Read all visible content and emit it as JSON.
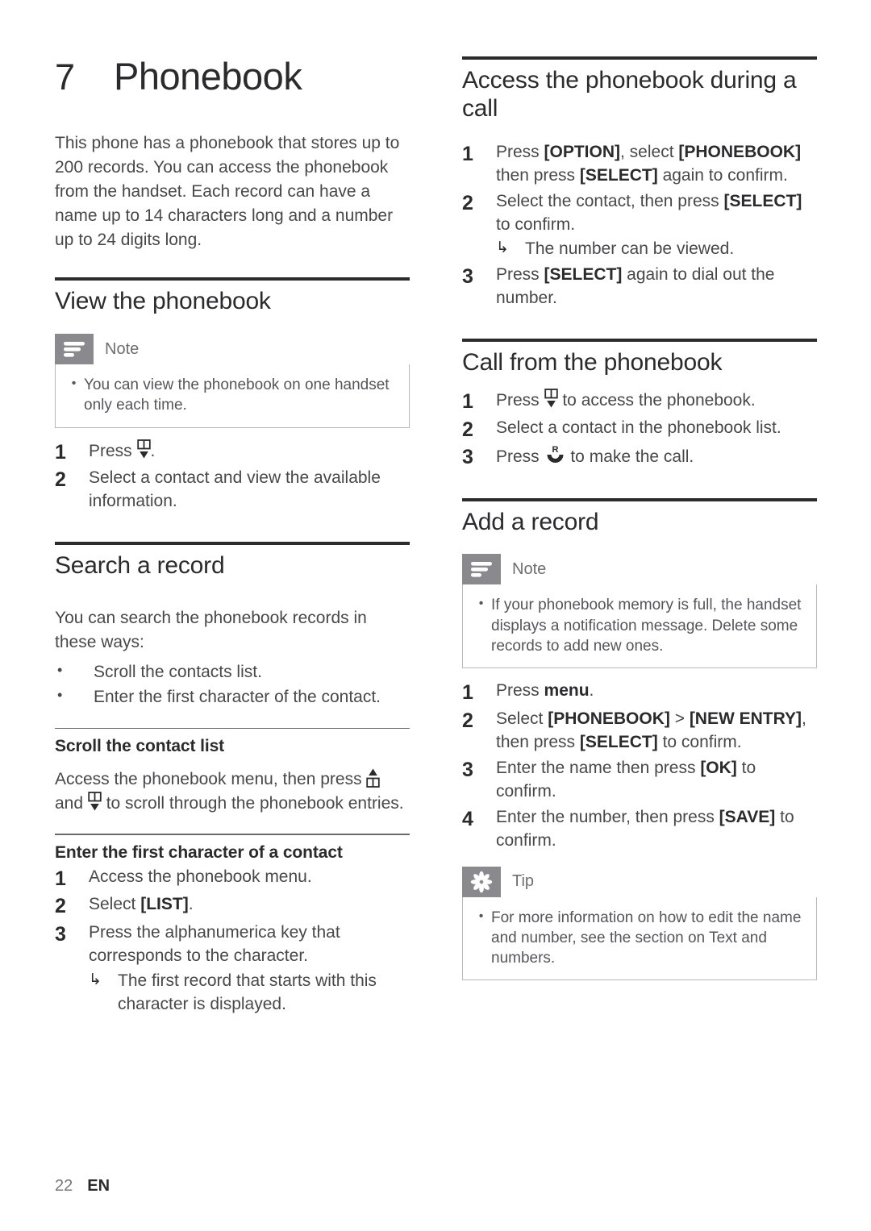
{
  "chapter": {
    "number": "7",
    "title": "Phonebook",
    "intro": "This phone has a phonebook that stores up to 200 records. You can access the phonebook from the handset. Each record can have a name up to 14 characters long and a number up to 24 digits long."
  },
  "left_column": {
    "view_phonebook": {
      "title": "View the phonebook",
      "note": {
        "label": "Note",
        "icon": "note-lines-icon",
        "items": [
          "You can view the phonebook on one handset only each time."
        ]
      },
      "steps": [
        {
          "num": "1",
          "text_before": "Press ",
          "icon": "phonebook-down-icon",
          "text_after": "."
        },
        {
          "num": "2",
          "text_before": "Select a contact and view the available information.",
          "icon": "",
          "text_after": ""
        }
      ]
    },
    "search_record": {
      "title": "Search a record",
      "intro": "You can search the phonebook records in these ways:",
      "bullets": [
        "Scroll the contacts list.",
        "Enter the first character of the contact."
      ],
      "scroll_contact_list": {
        "title": "Scroll the contact list",
        "text_1": "Access the phonebook menu, then press ",
        "icon_1": "phonebook-up-icon",
        "text_2": " and ",
        "icon_2": "phonebook-down-icon",
        "text_3": " to scroll through the phonebook entries."
      },
      "enter_first_character": {
        "title": "Enter the first character of a contact",
        "steps": [
          {
            "num": "1",
            "text": "Access the phonebook menu."
          },
          {
            "num": "2",
            "text_plain": "Select ",
            "text_bold": "[LIST]",
            "text_tail": "."
          },
          {
            "num": "3",
            "text": "Press the alphanumerica key that corresponds to the character.",
            "result": "The first record that starts with this character is displayed."
          }
        ]
      }
    }
  },
  "right_column": {
    "access_during_call": {
      "title": "Access the phonebook during a call",
      "steps": [
        {
          "num": "1",
          "parts": [
            {
              "t": "Press ",
              "b": false
            },
            {
              "t": "[OPTION]",
              "b": true
            },
            {
              "t": ", select ",
              "b": false
            },
            {
              "t": "[PHONEBOOK]",
              "b": true
            },
            {
              "t": " then press ",
              "b": false
            },
            {
              "t": "[SELECT]",
              "b": true
            },
            {
              "t": " again to confirm.",
              "b": false
            }
          ]
        },
        {
          "num": "2",
          "parts": [
            {
              "t": "Select the contact, then press ",
              "b": false
            },
            {
              "t": "[SELECT]",
              "b": true
            },
            {
              "t": " to confirm.",
              "b": false
            }
          ],
          "result": "The number can be viewed."
        },
        {
          "num": "3",
          "parts": [
            {
              "t": "Press ",
              "b": false
            },
            {
              "t": "[SELECT]",
              "b": true
            },
            {
              "t": " again to dial out the number.",
              "b": false
            }
          ]
        }
      ]
    },
    "call_from_phonebook": {
      "title": "Call from the phonebook",
      "steps": [
        {
          "num": "1",
          "text_before": "Press ",
          "icon": "phonebook-down-icon",
          "text_after": " to access the phonebook."
        },
        {
          "num": "2",
          "text_before": "Select a contact in the phonebook list.",
          "icon": "",
          "text_after": ""
        },
        {
          "num": "3",
          "text_before": "Press ",
          "icon": "call-r-icon",
          "text_after": " to make the call."
        }
      ]
    },
    "add_record": {
      "title": "Add a record",
      "note": {
        "label": "Note",
        "icon": "note-lines-icon",
        "items": [
          "If your phonebook memory is full, the handset displays a notification message. Delete some records to add new ones."
        ]
      },
      "steps": [
        {
          "num": "1",
          "parts": [
            {
              "t": "Press ",
              "b": false
            },
            {
              "t": "menu",
              "b": true
            },
            {
              "t": ".",
              "b": false
            }
          ]
        },
        {
          "num": "2",
          "parts": [
            {
              "t": "Select ",
              "b": false
            },
            {
              "t": "[PHONEBOOK]",
              "b": true
            },
            {
              "t": " > ",
              "b": false
            },
            {
              "t": "[NEW ENTRY]",
              "b": true
            },
            {
              "t": ", then press ",
              "b": false
            },
            {
              "t": "[SELECT]",
              "b": true
            },
            {
              "t": " to confirm.",
              "b": false
            }
          ]
        },
        {
          "num": "3",
          "parts": [
            {
              "t": "Enter the name then press ",
              "b": false
            },
            {
              "t": "[OK]",
              "b": true
            },
            {
              "t": " to confirm.",
              "b": false
            }
          ]
        },
        {
          "num": "4",
          "parts": [
            {
              "t": "Enter the number, then press ",
              "b": false
            },
            {
              "t": "[SAVE]",
              "b": true
            },
            {
              "t": " to confirm.",
              "b": false
            }
          ]
        }
      ],
      "tip": {
        "label": "Tip",
        "icon": "tip-star-icon",
        "items": [
          "For more information on how to edit the name and number, see the section on Text and numbers."
        ]
      }
    }
  },
  "footer": {
    "page_number": "22",
    "language": "EN"
  },
  "colors": {
    "rule_dark": "#2b2b2d",
    "callout_tab_gray": "#8a8a8e",
    "body_text": "#48484a"
  }
}
